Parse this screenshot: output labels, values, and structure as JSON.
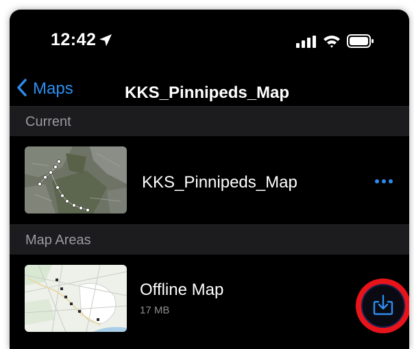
{
  "status_bar": {
    "time": "12:42",
    "icons": [
      "location-arrow-icon",
      "cellular-signal-icon",
      "wifi-icon",
      "battery-icon"
    ]
  },
  "nav": {
    "back_label": "Maps",
    "title": "KKS_Pinnipeds_Map"
  },
  "sections": {
    "current": "Current",
    "map_areas": "Map Areas"
  },
  "current_map": {
    "name": "KKS_Pinnipeds_Map",
    "thumbnail": "satellite-map-thumbnail",
    "menu_icon": "more-dots-icon"
  },
  "map_areas": [
    {
      "name": "Offline Map",
      "size": "17 MB",
      "thumbnail": "street-map-thumbnail",
      "action_icon": "download-icon"
    }
  ],
  "colors": {
    "accent": "#2d8ef0",
    "background": "#000000",
    "section_header_bg": "#1c1c1e",
    "secondary_text": "#8e8e93",
    "highlight_ring": "#e8141b"
  }
}
